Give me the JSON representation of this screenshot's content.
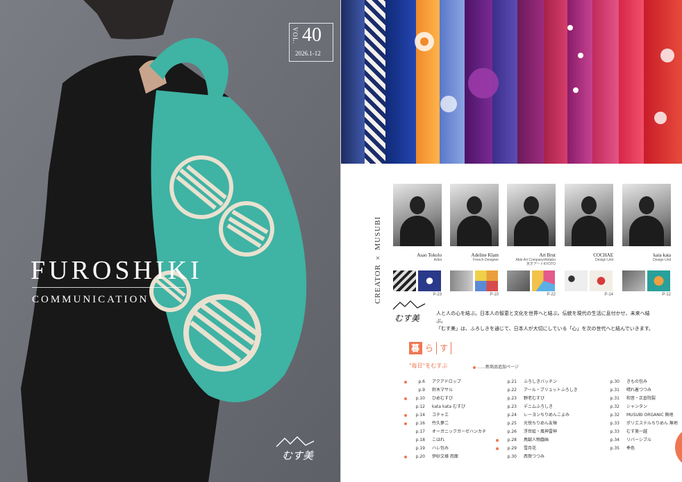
{
  "cover": {
    "vol_label": "VOL.",
    "vol_number": "40",
    "vol_date": "2026.1-12",
    "title": "FUROSHIKI",
    "subtitle": "COMMUNICATION",
    "logo_text": "むす美"
  },
  "creators_label": "CREATOR × MUSUBI",
  "creators": [
    {
      "name": "Asao Tokolo",
      "role": "Artist",
      "page": "P-23"
    },
    {
      "name": "Adeline Klam",
      "role": "French Designer",
      "page": "P-10"
    },
    {
      "name": "Art Brut",
      "role": "Able Art Company/Artlabo",
      "role2": "天才アートKYOTO",
      "page": "P-22"
    },
    {
      "name": "COCHAE",
      "role": "Design Unit",
      "page": "P-14"
    },
    {
      "name": "kata kata",
      "role": "Design Unit",
      "page": "P-12"
    }
  ],
  "brand": {
    "logo_text": "むす美",
    "mission_1": "人と人の心を結ぶ。日本人の智恵と文化を世界へと結ぶ。伝統を現代の生活に息付かせ、未来へ結ぶ。",
    "mission_2": "「むす美」は、ふろしきを通じて、日本人が大切にしている「心」を次の世代へと結んでいきます。"
  },
  "section": {
    "chars": [
      "暮",
      "ら",
      "す"
    ],
    "tagline": "\"毎日\"をむすぶ",
    "new_note": "……新商品追加ページ"
  },
  "toc": {
    "col1": [
      {
        "page": "p.6",
        "title": "アクアドロップ",
        "new": true
      },
      {
        "page": "p.9",
        "title": "鈴木マサル",
        "new": false
      },
      {
        "page": "p.10",
        "title": "ひめむすび",
        "new": true
      },
      {
        "page": "p.12",
        "title": "kata kata むすび",
        "new": false
      },
      {
        "page": "p.14",
        "title": "コチャエ",
        "new": true
      },
      {
        "page": "p.16",
        "title": "竹久夢二",
        "new": true
      },
      {
        "page": "p.17",
        "title": "オーガニックガーゼハンカチ",
        "new": false
      },
      {
        "page": "p.18",
        "title": "こはれ",
        "new": false
      },
      {
        "page": "p.19",
        "title": "ハレ包み",
        "new": false
      },
      {
        "page": "p.20",
        "title": "伊砂文様 両面",
        "new": true
      }
    ],
    "col2": [
      {
        "page": "p.21",
        "title": "ふろしきバッチン",
        "new": false
      },
      {
        "page": "p.22",
        "title": "アール・ブリュットふろしき",
        "new": false
      },
      {
        "page": "p.23",
        "title": "野老むすび",
        "new": false
      },
      {
        "page": "p.23",
        "title": "デニムふろしき",
        "new": false
      },
      {
        "page": "p.24",
        "title": "レーヨンちりめんこよみ",
        "new": false
      },
      {
        "page": "p.25",
        "title": "光悦ちりめん友禅",
        "new": false
      },
      {
        "page": "p.26",
        "title": "浮世絵・風神雷神",
        "new": false
      },
      {
        "page": "p.28",
        "title": "鳥獣人物戯画",
        "new": true
      },
      {
        "page": "p.29",
        "title": "雪月花",
        "new": true
      },
      {
        "page": "p.30",
        "title": "西賀つつみ",
        "new": false
      }
    ],
    "col3": [
      {
        "page": "p.30",
        "title": "きもの包み",
        "new": false
      },
      {
        "page": "p.31",
        "title": "晴れ着つつみ",
        "new": false
      },
      {
        "page": "p.31",
        "title": "和音・正倉院裂",
        "new": false
      },
      {
        "page": "p.32",
        "title": "シャンタン",
        "new": false
      },
      {
        "page": "p.32",
        "title": "MUSUBI ORGANIC 無地",
        "new": false
      },
      {
        "page": "p.33",
        "title": "ポリエステルちりめん 無地",
        "new": false
      },
      {
        "page": "p.33",
        "title": "むす美一越",
        "new": false
      },
      {
        "page": "p.34",
        "title": "リバーシブル",
        "new": false
      },
      {
        "page": "p.35",
        "title": "季色",
        "new": false
      }
    ]
  },
  "colors": {
    "accent": "#ee7752",
    "teal": "#3fb3a4",
    "cover_bg": "#6f7178"
  }
}
